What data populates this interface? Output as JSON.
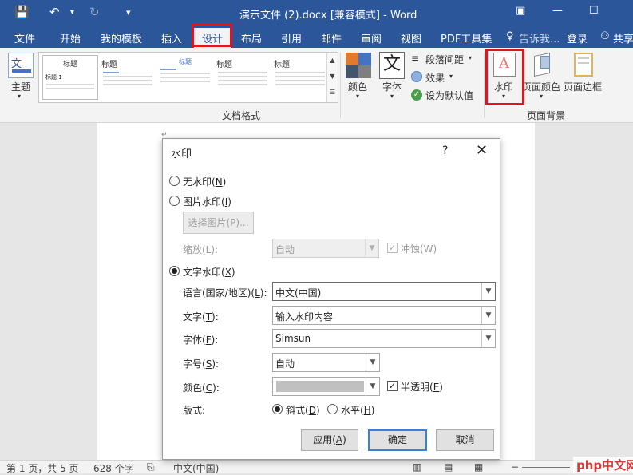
{
  "window": {
    "title": "演示文件 (2).docx [兼容模式] - Word",
    "save_icon": "💾",
    "undo_icon": "↶",
    "redo_icon": "↻",
    "customize_icon": "▾"
  },
  "tabs": [
    {
      "label": "文件"
    },
    {
      "label": "开始"
    },
    {
      "label": "我的模板"
    },
    {
      "label": "插入"
    },
    {
      "label": "设计"
    },
    {
      "label": "布局"
    },
    {
      "label": "引用"
    },
    {
      "label": "邮件"
    },
    {
      "label": "审阅"
    },
    {
      "label": "视图"
    },
    {
      "label": "PDF工具集"
    }
  ],
  "tell_me": "告诉我...",
  "login": "登录",
  "share": "共享",
  "ribbon": {
    "theme_label": "主题",
    "gallery": {
      "titles": [
        "标题",
        "标题",
        "标题",
        "标题",
        "标题"
      ],
      "heading1": "标题 1"
    },
    "doc_format_group": "文档格式",
    "colors_label": "颜色",
    "fonts_label": "字体",
    "fonts_glyph": "文",
    "para_spacing": "段落间距",
    "effects": "效果",
    "set_default": "设为默认值",
    "watermark": "水印",
    "page_color": "页面颜色",
    "page_borders": "页面边框",
    "page_bg_group": "页面背景"
  },
  "dialog": {
    "title": "水印",
    "help": "?",
    "close": "✕",
    "no_watermark": {
      "text": "无水印(",
      "key": "N",
      "end": ")"
    },
    "picture_watermark": {
      "text": "图片水印(",
      "key": "I",
      "end": ")"
    },
    "select_picture": "选择图片(P)...",
    "scale_label": "缩放(L):",
    "scale_value": "自动",
    "washout": "冲蚀(W)",
    "text_watermark": {
      "text": "文字水印(",
      "key": "X",
      "end": ")"
    },
    "language_label": {
      "text": "语言(国家/地区)(",
      "key": "L",
      "end": "):"
    },
    "language_value": "中文(中国)",
    "text_label": {
      "text": "文字(",
      "key": "T",
      "end": "):"
    },
    "text_value": "输入水印内容",
    "font_label": {
      "text": "字体(",
      "key": "F",
      "end": "):"
    },
    "font_value": "Simsun",
    "size_label": {
      "text": "字号(",
      "key": "S",
      "end": "):"
    },
    "size_value": "自动",
    "color_label": {
      "text": "颜色(",
      "key": "C",
      "end": "):"
    },
    "semitransparent": {
      "text": "半透明(",
      "key": "E",
      "end": ")"
    },
    "layout_label": "版式:",
    "diagonal": {
      "text": "斜式(",
      "key": "D",
      "end": ")"
    },
    "horizontal": {
      "text": "水平(",
      "key": "H",
      "end": ")"
    },
    "apply": {
      "text": "应用(",
      "key": "A",
      "end": ")"
    },
    "ok": "确定",
    "cancel": "取消"
  },
  "status": {
    "page": "第 1 页，共 5 页",
    "words": "628 个字",
    "lang": "中文(中国)"
  },
  "site_watermark": "php中文网",
  "colors": {
    "brand": "#2b579a",
    "highlight": "#e0141b"
  }
}
